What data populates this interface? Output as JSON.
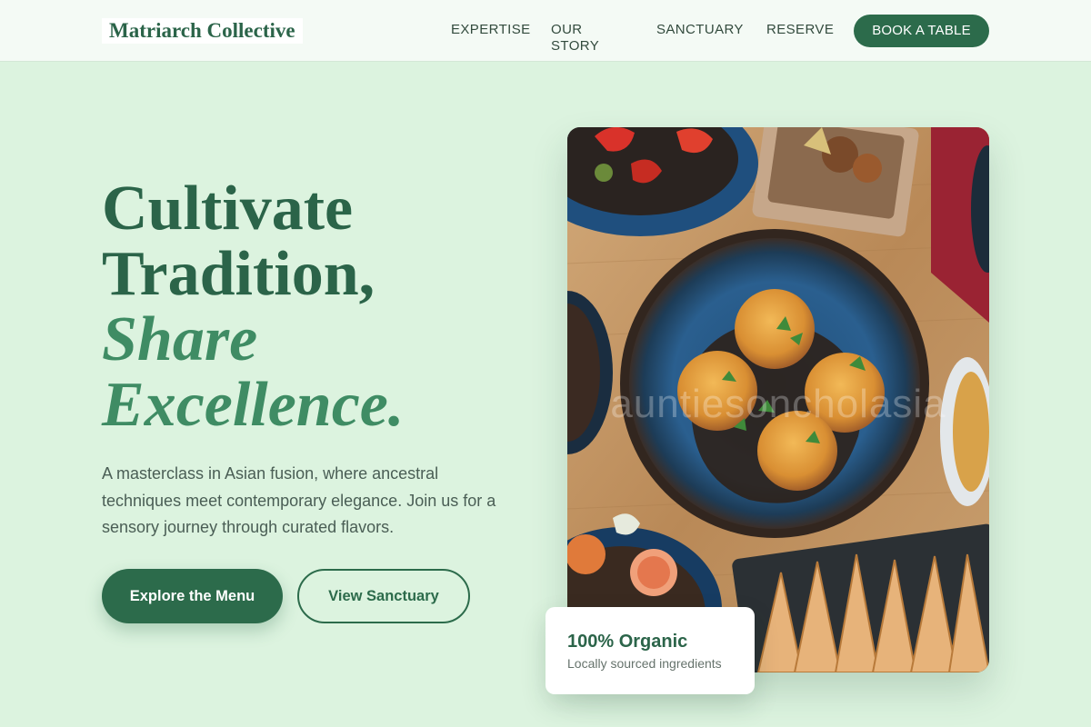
{
  "header": {
    "logo": "Matriarch Collective",
    "nav": [
      "EXPERTISE",
      "OUR STORY",
      "SANCTUARY",
      "RESERVE"
    ],
    "cta": "BOOK A TABLE"
  },
  "hero": {
    "title_line1": "Cultivate",
    "title_line2": "Tradition,",
    "title_italic_line1": "Share",
    "title_italic_line2": "Excellence",
    "title_period": ".",
    "description": "A masterclass in Asian fusion, where ancestral techniques meet contemporary elegance. Join us for a sensory journey through curated flavors.",
    "primary_button": "Explore the Menu",
    "secondary_button": "View Sanctuary",
    "image_watermark": "auntiesoncholasia"
  },
  "badge": {
    "title": "100% Organic",
    "subtitle": "Locally sourced ingredients"
  },
  "colors": {
    "background": "#dcf3df",
    "brand_green": "#2c6b4b",
    "accent_green": "#3f8c64"
  }
}
